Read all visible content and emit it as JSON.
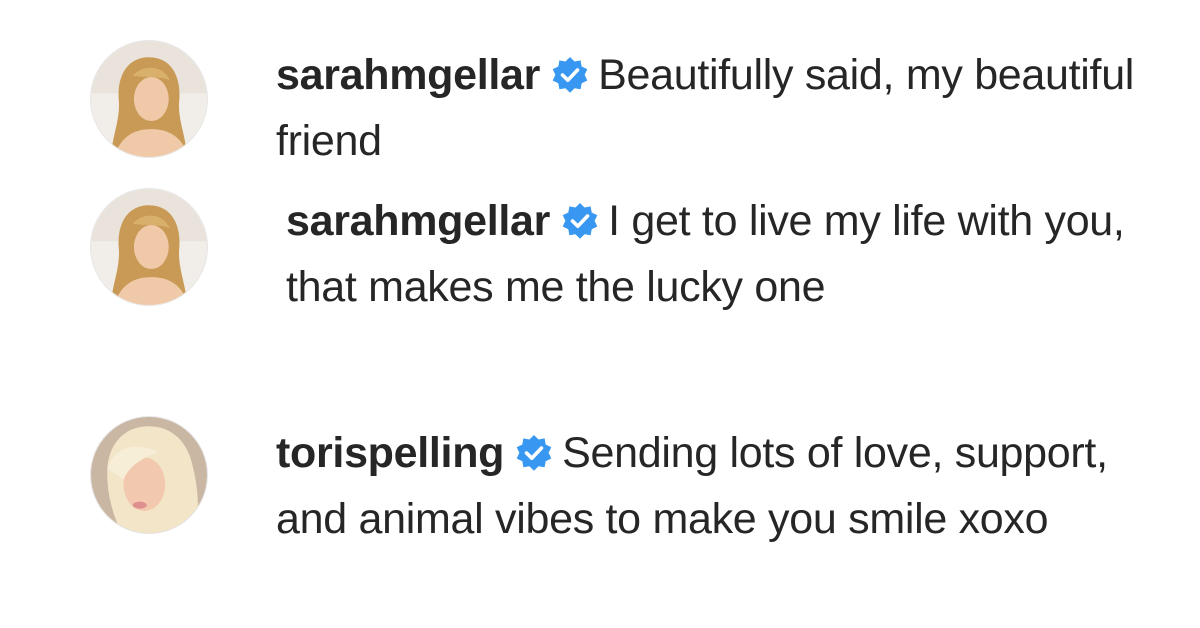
{
  "comments": [
    {
      "username": "sarahmgellar",
      "verified": true,
      "text": "Beautifully said, my beautiful friend",
      "avatar_icon": "profile-photo-sarahmgellar"
    },
    {
      "username": "sarahmgellar",
      "verified": true,
      "text": "I get to live my life with you, that makes me the lucky one",
      "avatar_icon": "profile-photo-sarahmgellar"
    },
    {
      "username": "torispelling",
      "verified": true,
      "text": "Sending lots of love, support, and animal vibes to make you smile xoxo",
      "avatar_icon": "profile-photo-torispelling"
    }
  ],
  "colors": {
    "verified_badge": "#3897f0",
    "text": "#262626",
    "background": "#ffffff"
  }
}
